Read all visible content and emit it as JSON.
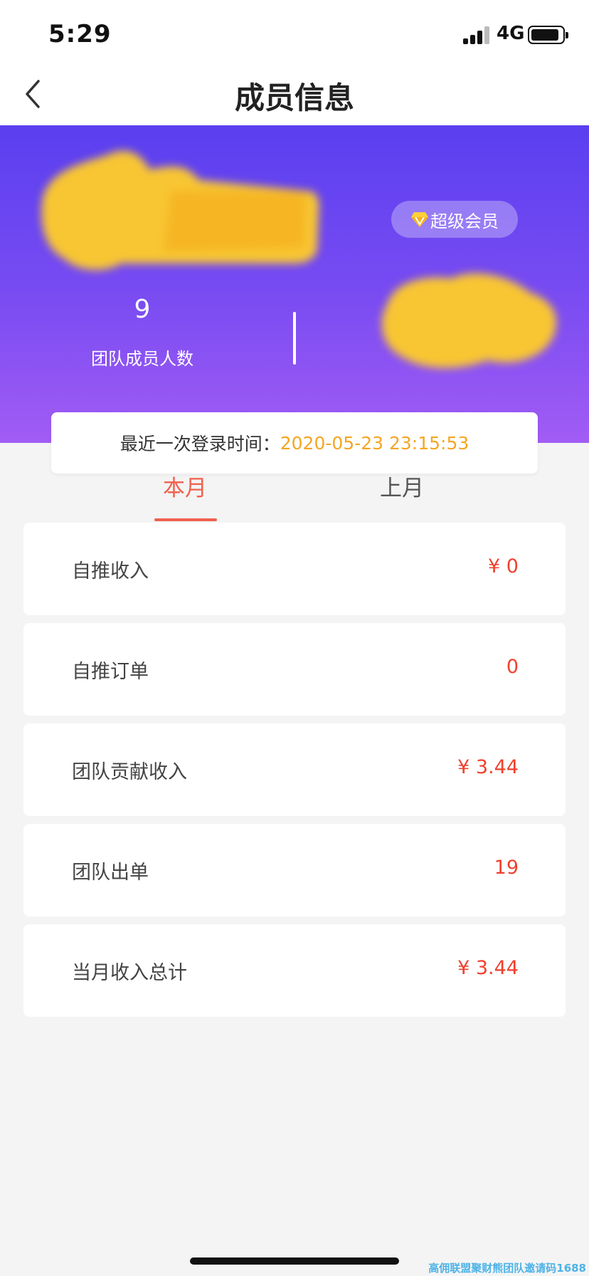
{
  "status_bar": {
    "time": "5:29",
    "network": "4G"
  },
  "nav": {
    "title": "成员信息"
  },
  "header": {
    "vip_badge": "超级会员",
    "member_count": "9",
    "member_count_label": "团队成员人数"
  },
  "login": {
    "label": "最近一次登录时间：",
    "time": "2020-05-23 23:15:53"
  },
  "tabs": [
    {
      "label": "本月",
      "active": true
    },
    {
      "label": "上月",
      "active": false
    }
  ],
  "stats": [
    {
      "label": "自推收入",
      "value": "¥ 0"
    },
    {
      "label": "自推订单",
      "value": "0"
    },
    {
      "label": "团队贡献收入",
      "value": "¥ 3.44"
    },
    {
      "label": "团队出单",
      "value": "19"
    },
    {
      "label": "当月收入总计",
      "value": "¥ 3.44"
    }
  ],
  "watermark": "高佣联盟聚财熊团队邀请码1688",
  "colors": {
    "accent": "#f0604d",
    "value_red": "#f0402d",
    "login_time": "#f5a623",
    "header_top": "#5a3ff0",
    "header_bottom": "#a25cf4"
  }
}
